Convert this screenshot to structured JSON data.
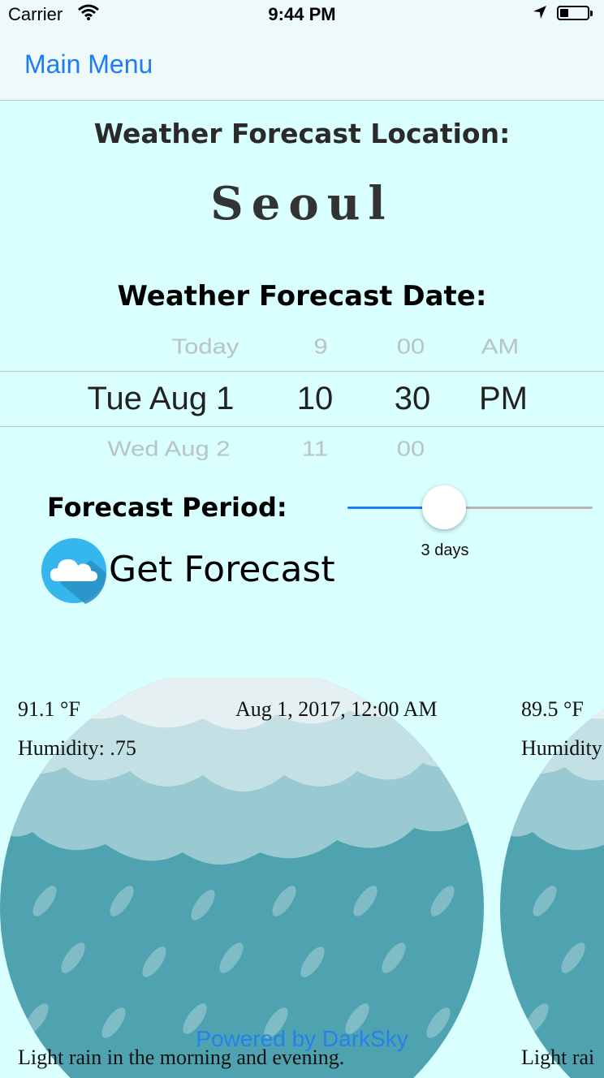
{
  "status_bar": {
    "carrier": "Carrier",
    "time": "9:44 PM"
  },
  "nav": {
    "back_label": "Main Menu"
  },
  "location": {
    "heading": "Weather Forecast Location:",
    "city": "Seoul"
  },
  "date_picker": {
    "heading": "Weather Forecast Date:",
    "above": [
      "Today",
      "9",
      "00",
      "AM"
    ],
    "selected": [
      "Tue Aug 1",
      "10",
      "30",
      "PM"
    ],
    "below": [
      "Wed Aug 2",
      "11",
      "00",
      ""
    ]
  },
  "forecast_period": {
    "label": "Forecast Period:",
    "value_label": "3 days"
  },
  "get_forecast": {
    "label": "Get Forecast",
    "icon": "cloud-icon"
  },
  "cards": [
    {
      "temp": "91.1 °F",
      "datetime": "Aug 1, 2017, 12:00 AM",
      "humidity": "Humidity: .75",
      "summary": "Light rain in the morning and evening.",
      "icon": "rain-icon"
    },
    {
      "temp": "89.5 °F",
      "datetime": "",
      "humidity": "Humidity",
      "summary": "Light rai",
      "icon": "rain-icon"
    }
  ],
  "footer": {
    "powered_by": "Powered by DarkSky"
  },
  "colors": {
    "accent": "#1e7cf5",
    "background": "#d9fffe",
    "rain_sky": "#4fa3b1"
  }
}
